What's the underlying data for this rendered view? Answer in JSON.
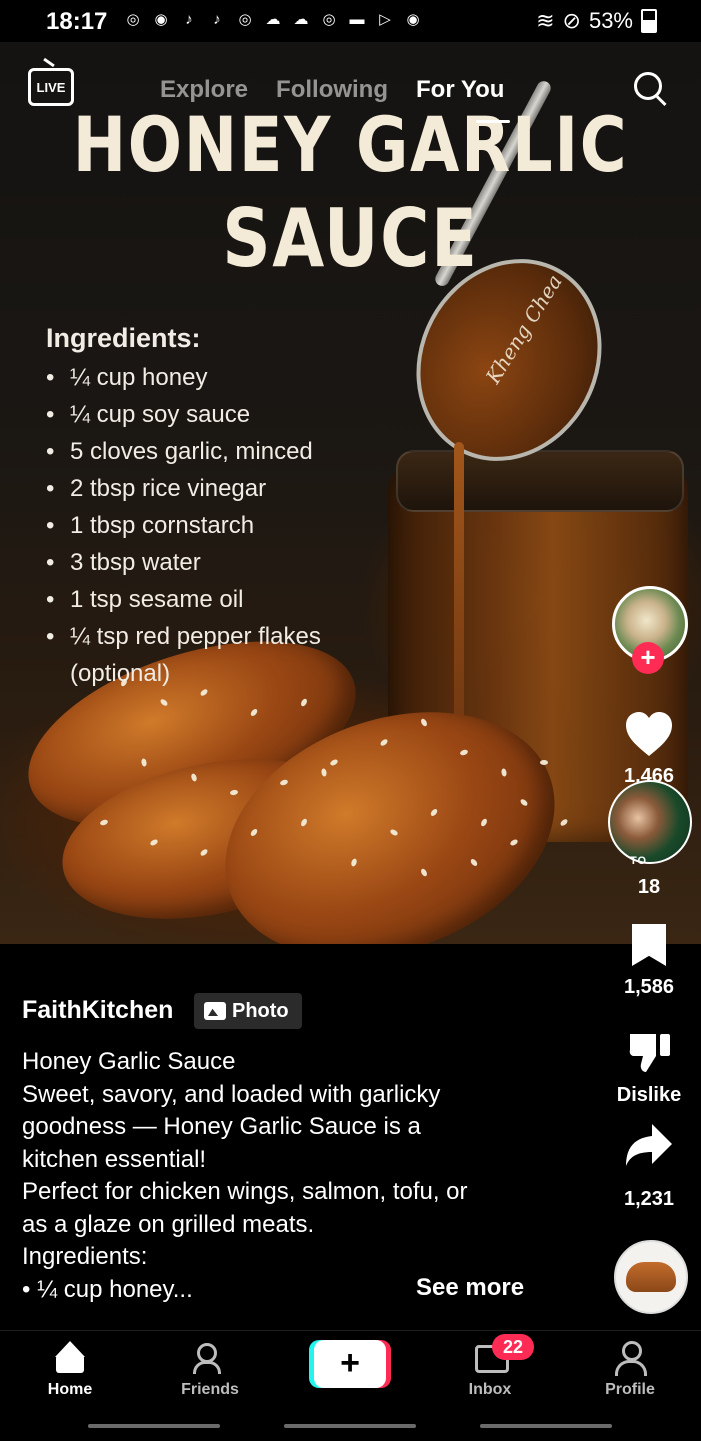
{
  "status_bar": {
    "time": "18:17",
    "battery": "53%",
    "notification_icons": [
      "instagram-icon",
      "messenger-icon",
      "tiktok-icon",
      "tiktok-icon",
      "instagram-icon",
      "soundcloud-icon",
      "soundcloud-icon",
      "instagram-icon",
      "folder-icon",
      "play-store-icon",
      "messenger-icon"
    ]
  },
  "top_nav": {
    "live_label": "LIVE",
    "tabs": [
      {
        "label": "Explore",
        "active": false
      },
      {
        "label": "Following",
        "active": false
      },
      {
        "label": "For You",
        "active": true
      }
    ]
  },
  "post": {
    "image_title_line1": "HONEY GARLIC",
    "image_title_line2": "SAUCE",
    "spoon_signature": "Kheng Chea",
    "ingredients_heading": "Ingredients:",
    "ingredients": [
      "¼ cup honey",
      "¼ cup soy sauce",
      "5 cloves garlic, minced",
      "2 tbsp rice vinegar",
      "1 tbsp cornstarch",
      "3 tbsp water",
      "1 tsp sesame oil",
      "¼ tsp red pepper flakes (optional)"
    ]
  },
  "rail": {
    "like_count": "1,466",
    "comment_count": "18",
    "comment_avatar_text": "TO",
    "bookmark_count": "1,586",
    "dislike_label": "Dislike",
    "share_count": "1,231"
  },
  "caption": {
    "author": "FaithKitchen",
    "badge": "Photo",
    "lines": [
      "Honey Garlic Sauce",
      "Sweet, savory, and loaded with garlicky",
      "goodness — Honey Garlic Sauce is a",
      "kitchen essential!",
      "Perfect for chicken wings, salmon, tofu, or",
      "as a glaze on grilled meats.",
      "Ingredients:",
      "• ¼ cup honey..."
    ],
    "see_more": "See more"
  },
  "bottom_nav": {
    "items": [
      {
        "label": "Home",
        "active": true
      },
      {
        "label": "Friends",
        "active": false
      },
      {
        "label": "Inbox",
        "active": false,
        "badge": "22"
      },
      {
        "label": "Profile",
        "active": false
      }
    ]
  },
  "colors": {
    "accent_red": "#fe2c55",
    "accent_cyan": "#25f4ee",
    "background": "#000000",
    "title_cream": "#f3ead8"
  }
}
